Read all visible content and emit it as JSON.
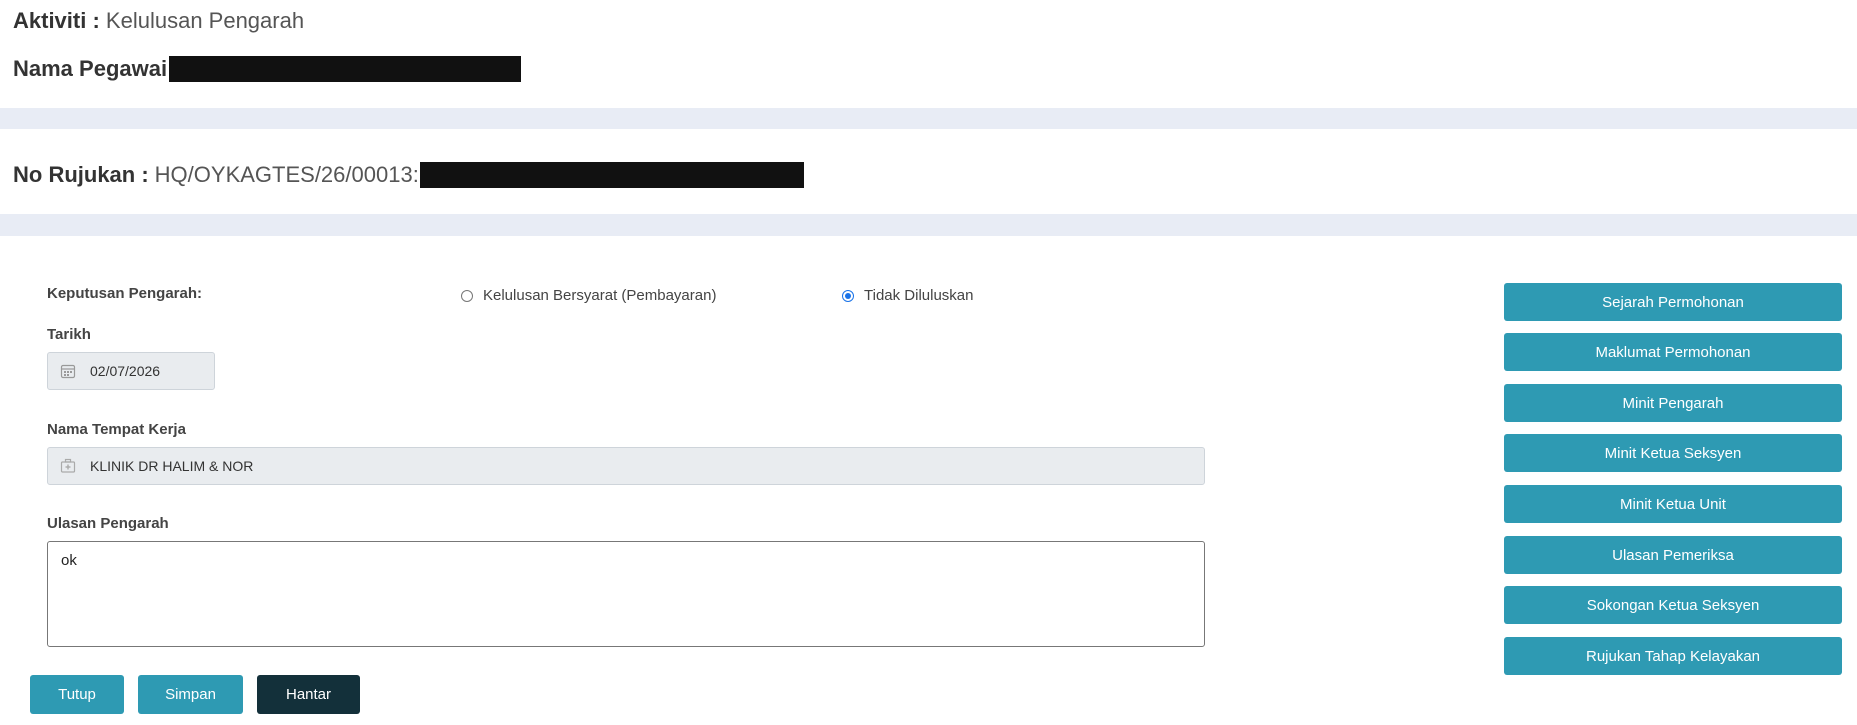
{
  "header": {
    "activity_label": "Aktiviti :",
    "activity_value": "Kelulusan Pengarah",
    "employee_label": "Nama Pegawai",
    "reference_label": "No Rujukan :",
    "reference_value": "HQ/OYKAGTES/26/00013:"
  },
  "form": {
    "decision_label": "Keputusan Pengarah:",
    "radio_options": [
      {
        "label": "Kelulusan Bersyarat (Pembayaran)",
        "checked": false
      },
      {
        "label": "Tidak Diluluskan",
        "checked": true
      }
    ],
    "date_label": "Tarikh",
    "date_value": "02/07/2026",
    "workplace_label": "Nama Tempat Kerja",
    "workplace_value": "KLINIK DR HALIM & NOR",
    "remarks_label": "Ulasan Pengarah",
    "remarks_value": "ok"
  },
  "actions": {
    "close": "Tutup",
    "save": "Simpan",
    "submit": "Hantar"
  },
  "side_buttons": [
    "Sejarah Permohonan",
    "Maklumat Permohonan",
    "Minit Pengarah",
    "Minit Ketua Seksyen",
    "Minit Ketua Unit",
    "Ulasan Pemeriksa",
    "Sokongan Ketua Seksyen",
    "Rujukan Tahap Kelayakan"
  ],
  "colors": {
    "button_teal": "#2e9ab3",
    "button_dark": "#13303a",
    "band": "#e8ecf5",
    "radio_accent": "#1a73e8"
  }
}
